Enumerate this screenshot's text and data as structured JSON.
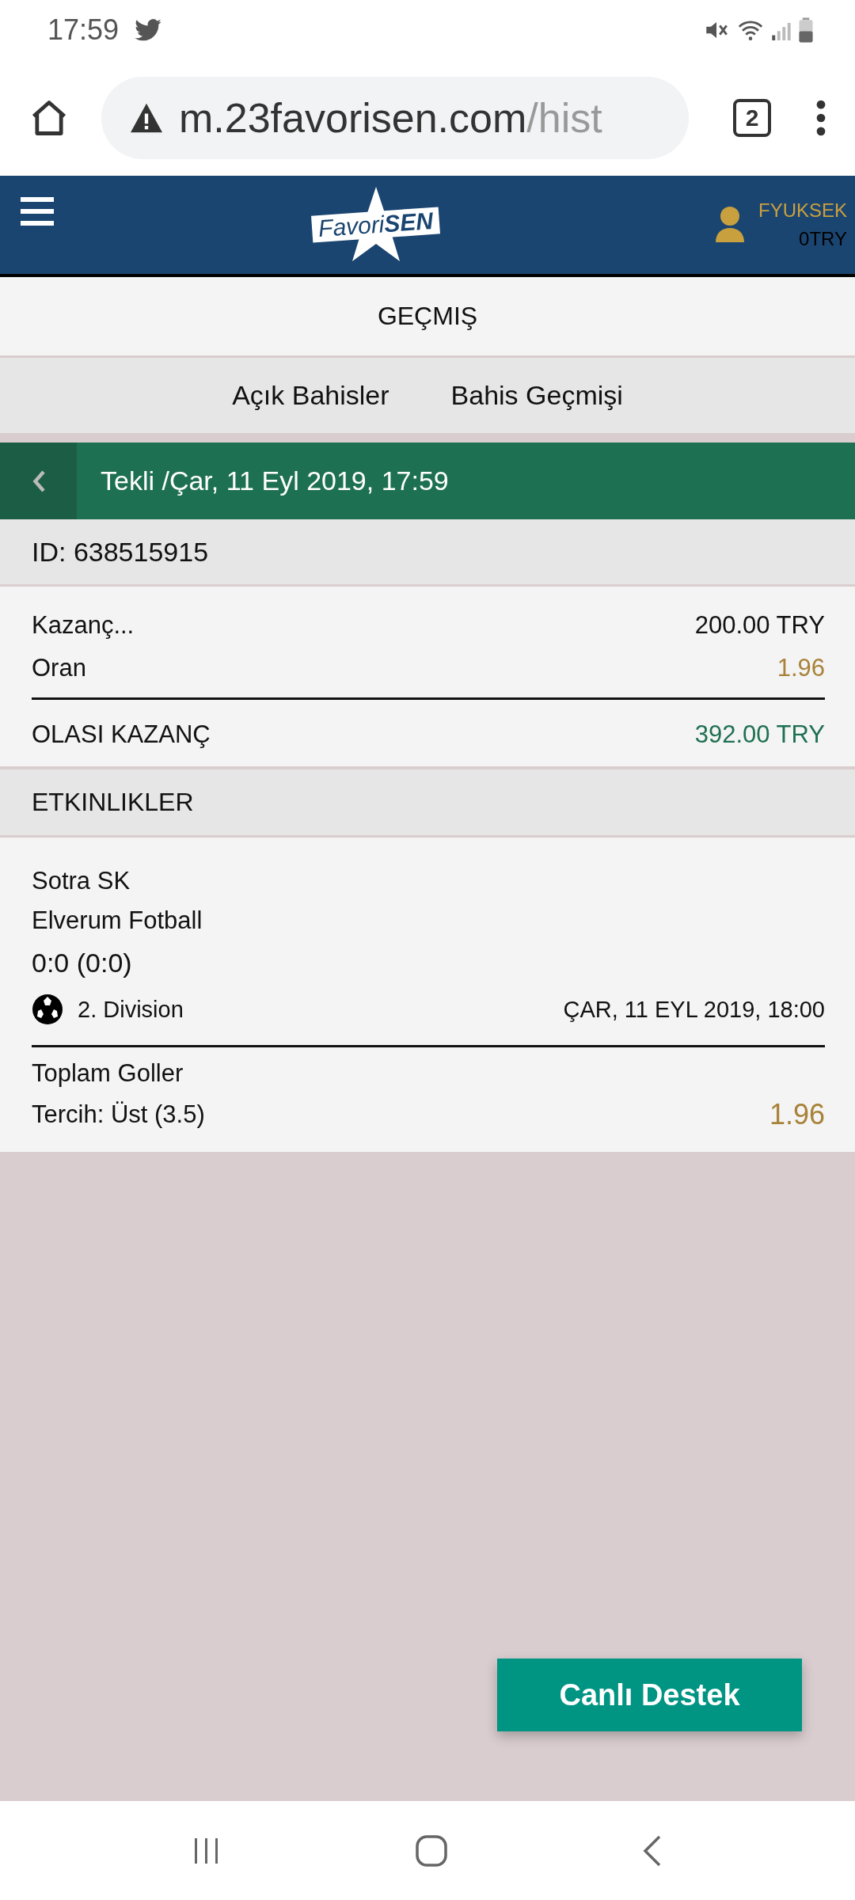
{
  "status_bar": {
    "time": "17:59"
  },
  "browser": {
    "url_host": "m.23favorisen.com",
    "url_path": "/hist",
    "tab_count": "2"
  },
  "header": {
    "logo": "Favori**SEN**",
    "username": "FYUKSEK",
    "balance": "0TRY"
  },
  "page_title": "GEÇMIŞ",
  "tabs": [
    {
      "label": "Açık Bahisler"
    },
    {
      "label": "Bahis Geçmişi"
    }
  ],
  "bet": {
    "title": "Tekli /Çar, 11 Eyl 2019, 17:59",
    "id": "ID: 638515915",
    "summary": [
      {
        "label": "Kazanç...",
        "value": "200.00 TRY",
        "kind": "plain"
      },
      {
        "label": "Oran",
        "value": "1.96",
        "kind": "odds"
      }
    ],
    "total": {
      "label": "OLASI KAZANÇ",
      "value": "392.00 TRY"
    }
  },
  "events_title": "ETKINLIKLER",
  "events": [
    {
      "home": "Sotra SK",
      "away": "Elverum Fotball",
      "score": "0:0 (0:0)",
      "league": "2. Division",
      "date": "ÇAR, 11 EYL 2019, 18:00",
      "market": "Toplam Goller",
      "pick": "Tercih: Üst (3.5)",
      "odds": "1.96"
    }
  ],
  "support_button": "Canlı Destek"
}
